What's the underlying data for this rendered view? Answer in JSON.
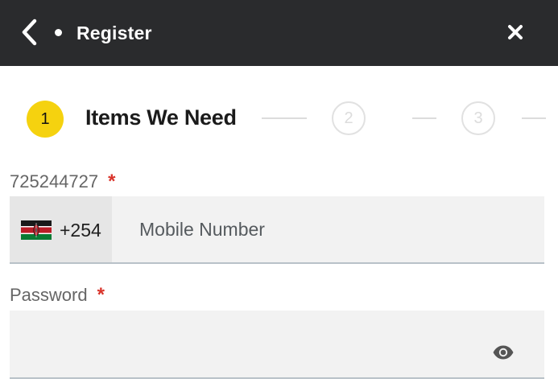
{
  "header": {
    "title": "Register",
    "back_icon": "chevron-left-icon",
    "close_icon": "close-icon"
  },
  "stepper": {
    "active_step": "1",
    "active_label": "Items We Need",
    "step2": "2",
    "step3": "3",
    "accent": "#f5d20f"
  },
  "phone": {
    "label": "725244727",
    "required": "*",
    "country_code": "+254",
    "flag": "kenya-flag-icon",
    "placeholder": "Mobile Number"
  },
  "password": {
    "label": "Password",
    "required": "*",
    "toggle_icon": "eye-icon"
  },
  "colors": {
    "header_bg": "#2a2b2d",
    "required": "#d9342b"
  }
}
